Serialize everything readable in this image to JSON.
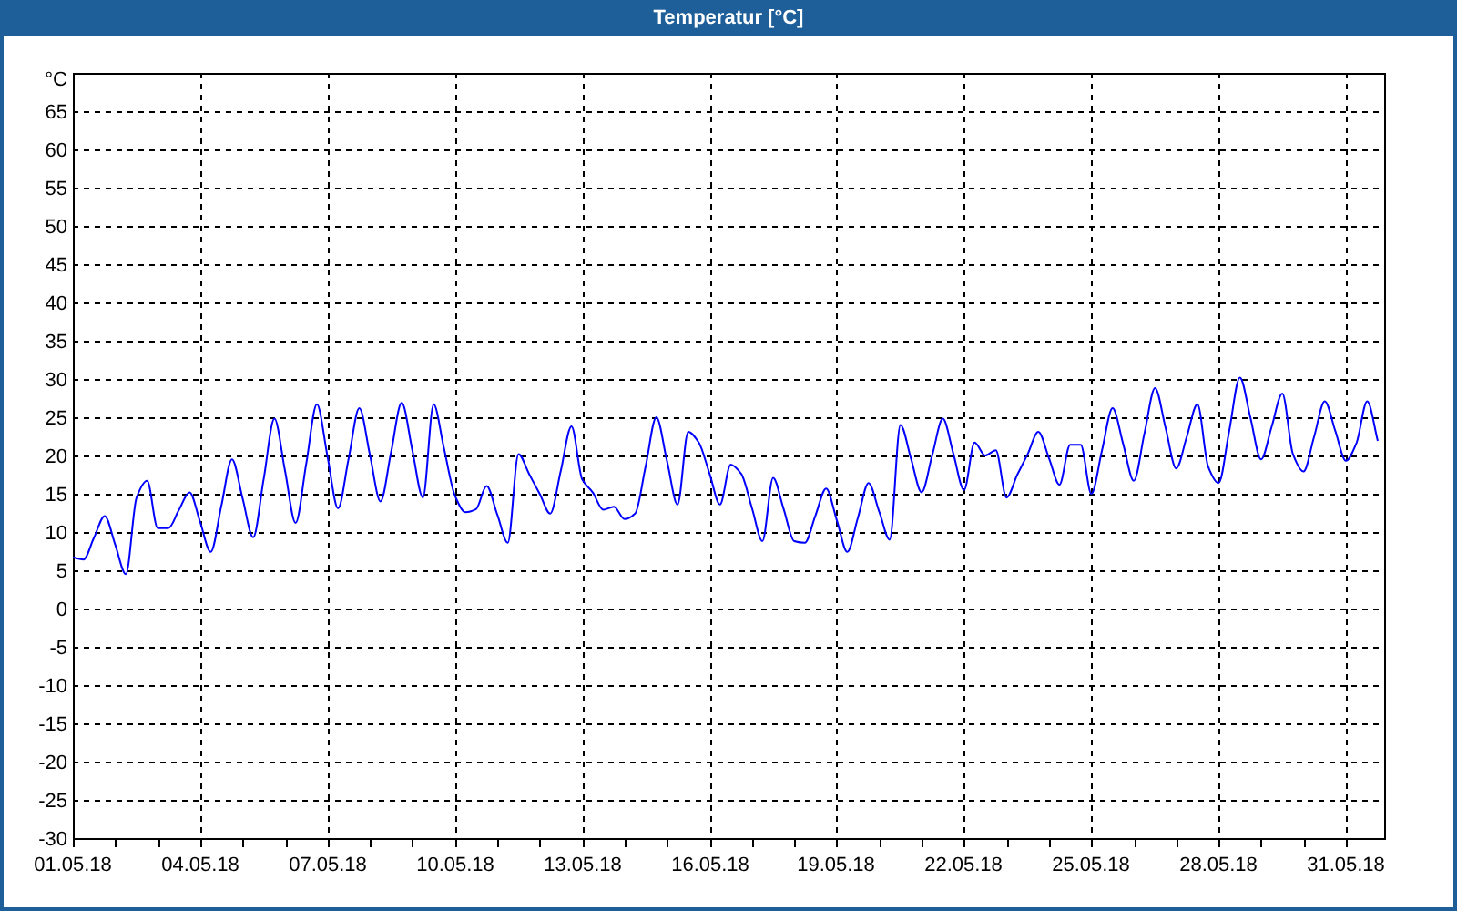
{
  "window": {
    "title": "Temperatur [°C]"
  },
  "chart": {
    "chart_data": {
      "type": "line",
      "ylabel": "°C",
      "categories": [
        "01.05.18",
        null,
        null,
        null,
        null,
        null,
        null,
        null,
        null,
        null,
        null,
        null,
        "04.05.18",
        null,
        null,
        null,
        null,
        null,
        null,
        null,
        null,
        null,
        null,
        null,
        "07.05.18",
        null,
        null,
        null,
        null,
        null,
        null,
        null,
        null,
        null,
        null,
        null,
        "10.05.18",
        null,
        null,
        null,
        null,
        null,
        null,
        null,
        null,
        null,
        null,
        null,
        "13.05.18",
        null,
        null,
        null,
        null,
        null,
        null,
        null,
        null,
        null,
        null,
        null,
        "16.05.18",
        null,
        null,
        null,
        null,
        null,
        null,
        null,
        null,
        null,
        null,
        null,
        "19.05.18",
        null,
        null,
        null,
        null,
        null,
        null,
        null,
        null,
        null,
        null,
        null,
        "22.05.18",
        null,
        null,
        null,
        null,
        null,
        null,
        null,
        null,
        null,
        null,
        null,
        "25.05.18",
        null,
        null,
        null,
        null,
        null,
        null,
        null,
        null,
        null,
        null,
        null,
        "28.05.18",
        null,
        null,
        null,
        null,
        null,
        null,
        null,
        null,
        null,
        null,
        null,
        "31.05.18",
        null,
        null,
        null
      ],
      "series": [
        {
          "color": "#0000ff",
          "values": [
            6.7,
            6.4,
            9.3,
            12.1,
            8.3,
            4.5,
            14.5,
            16.7,
            10.5,
            10.5,
            12.9,
            15.2,
            11.3,
            7.4,
            13.5,
            19.5,
            14.4,
            9.3,
            17.1,
            24.8,
            18,
            11.2,
            19,
            26.7,
            19.9,
            13.1,
            19.7,
            26.2,
            20.1,
            14,
            20.5,
            26.9,
            20.7,
            14.5,
            26.7,
            20.8,
            14.8,
            12.6,
            13,
            16,
            12.3,
            8.6,
            20.2,
            17.6,
            15,
            12.4,
            18.1,
            23.8,
            16.9,
            15.2,
            12.9,
            13.3,
            11.7,
            12.4,
            18.7,
            25,
            19.3,
            13.6,
            23.1,
            21.7,
            17.7,
            13.6,
            18.8,
            17.6,
            13.2,
            8.8,
            17.1,
            13,
            8.8,
            8.6,
            12.2,
            15.7,
            11.6,
            7.4,
            11.9,
            16.4,
            12.7,
            9,
            24,
            19.6,
            15.2,
            20,
            24.8,
            20.2,
            15.5,
            21.7,
            20,
            20.7,
            14.5,
            17.4,
            20.2,
            23.1,
            19.7,
            16.2,
            21.4,
            21.4,
            15,
            20.6,
            26.2,
            21.5,
            16.7,
            22.8,
            28.8,
            23.6,
            18.3,
            22.5,
            26.7,
            18.6,
            16.4,
            23.3,
            30.2,
            24.9,
            19.5,
            23.8,
            28.1,
            20.2,
            17.9,
            22.5,
            27.1,
            23.2,
            19.3,
            21.7,
            27.1,
            21.9
          ]
        }
      ],
      "ylim": [
        -30,
        70
      ],
      "grid": true,
      "yticks": [
        -30,
        -25,
        -20,
        -15,
        -10,
        -5,
        0,
        5,
        10,
        15,
        20,
        25,
        30,
        35,
        40,
        45,
        50,
        55,
        60,
        65
      ]
    }
  }
}
